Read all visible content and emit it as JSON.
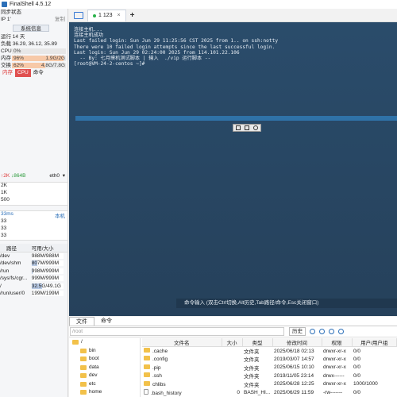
{
  "app": {
    "title": "FinalShell 4.5.12"
  },
  "sidebar": {
    "sync_status": "同步状态",
    "ip_label": "IP",
    "ip_value": "1'",
    "copy_label": "复制",
    "sysinfo_button": "系统信息",
    "uptime": "运行 14 天",
    "load": "负载 36.29, 36.12, 35.89",
    "cpu": {
      "label": "CPU",
      "value": "0%",
      "fraction": 0.0
    },
    "mem": {
      "label": "内存",
      "percent": "96%",
      "detail": "1.9G/2G",
      "fraction": 0.96
    },
    "swap": {
      "label": "交换",
      "percent": "62%",
      "detail": "4.8G/7.8G",
      "fraction": 0.62
    },
    "tabs": [
      "内存",
      "CPU",
      "命令"
    ],
    "net": {
      "up": "↑2K",
      "down": "↓864B",
      "iface": "eth0",
      "ticks": [
        "2K",
        "1K",
        "500"
      ]
    },
    "ping": {
      "ms": "33ms",
      "local": "本机",
      "ticks": [
        "33",
        "33",
        "33"
      ]
    },
    "disk_headers": [
      "路径",
      "可用/大小"
    ],
    "disks": [
      {
        "path": "/dev",
        "usage": "988M/988M",
        "fraction": 0.0
      },
      {
        "path": "/dev/shm",
        "usage": "807M/999M",
        "fraction": 0.19
      },
      {
        "path": "/run",
        "usage": "998M/999M",
        "fraction": 0.01
      },
      {
        "path": "/sys/fs/cgr...",
        "usage": "999M/999M",
        "fraction": 0.0
      },
      {
        "path": "/",
        "usage": "32.5G/49.1G",
        "fraction": 0.34
      },
      {
        "path": "/run/user/0",
        "usage": "199M/199M",
        "fraction": 0.0
      }
    ]
  },
  "tabs": {
    "session_label": "1 123"
  },
  "terminal": {
    "lines": [
      "连接主机...",
      "连接主机成功",
      "Last failed login: Sun Jun 29 11:25:56 CST 2025 from 1.. on ssh:notty",
      "There were 10 failed login attempts since the last successful login.",
      "Last login: Sun Jun 29 02:24:00 2025 from 114.101.22.106",
      "  -- By: 七月摸机测试脚本 | 输入  ./vip 运行脚本 --",
      "[root@VM-24-2-centos ~]#"
    ],
    "command_hint": "命令输入 (双击Ctrl切换,Alt历史,Tab路径/命令,Esc关闭窗口)"
  },
  "files": {
    "tab_files": "文件",
    "tab_commands": "命令",
    "path": "/root",
    "history_button": "历史",
    "tree": [
      "/",
      "bin",
      "boot",
      "data",
      "dev",
      "etc",
      "home"
    ],
    "headers": [
      "文件名",
      "大小",
      "类型",
      "修改时间",
      "权限",
      "用户/用户组"
    ],
    "rows": [
      {
        "name": ".cache",
        "size": "",
        "type": "文件夹",
        "mtime": "2025/06/18 02:13",
        "perm": "drwxr-xr-x",
        "owner": "0/0"
      },
      {
        "name": ".config",
        "size": "",
        "type": "文件夹",
        "mtime": "2019/03/07 14:57",
        "perm": "drwxr-xr-x",
        "owner": "0/0"
      },
      {
        "name": ".pip",
        "size": "",
        "type": "文件夹",
        "mtime": "2025/06/15 10:10",
        "perm": "drwxr-xr-x",
        "owner": "0/0"
      },
      {
        "name": ".ssh",
        "size": "",
        "type": "文件夹",
        "mtime": "2019/11/05 23:14",
        "perm": "drwx------",
        "owner": "0/0"
      },
      {
        "name": "chlibs",
        "size": "",
        "type": "文件夹",
        "mtime": "2025/06/28 12:25",
        "perm": "drwxr-xr-x",
        "owner": "1000/1000"
      },
      {
        "name": ".bash_history",
        "size": "0",
        "type": "BASH_HI...",
        "mtime": "2025/06/29 11:59",
        "perm": "-rw-------",
        "owner": "0/0"
      }
    ]
  },
  "colors": {
    "terminal_bg": "#2a4c6b",
    "mem_fill": "#f7c9a8",
    "swap_fill": "#f7c9a8",
    "active_tab": "#e05050"
  }
}
